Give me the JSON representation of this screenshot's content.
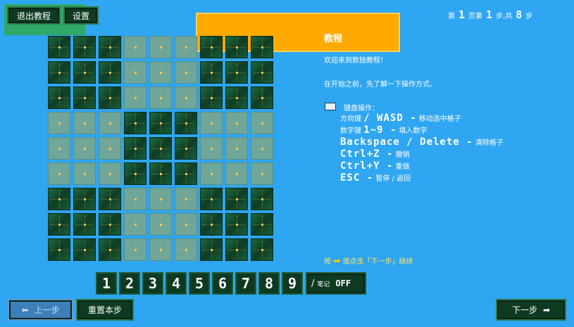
{
  "top_buttons": {
    "exit": "退出教程",
    "settings": "设置"
  },
  "step_counter": {
    "prefix": "第",
    "page": "1",
    "mid": "页第",
    "step": "1",
    "step_label": "步,共",
    "total": "8",
    "suffix": "步"
  },
  "title": "教程",
  "panel": {
    "welcome": "欢迎来到数独教程！",
    "intro": "在开始之前，先了解一下操作方式。",
    "keyboard_heading": "键盘操作：",
    "keyboard_icon": "keyboard-icon",
    "lines": [
      {
        "label": "方向键",
        "keys": "/ WASD -",
        "desc": "移动选中格子"
      },
      {
        "label": "数字键",
        "keys": "1~9 -",
        "desc": "填入数字"
      },
      {
        "label": "",
        "keys": "Backspace / Delete -",
        "desc": "清除格子"
      },
      {
        "label": "",
        "keys": "Ctrl+Z -",
        "desc": "撤销"
      },
      {
        "label": "",
        "keys": "Ctrl+Y -",
        "desc": "重做"
      },
      {
        "label": "",
        "keys": "ESC -",
        "desc": "暂停 / 返回"
      }
    ],
    "hint_prefix": "按",
    "hint_icon": "arrow-right-icon",
    "hint": "或点击「下一步」继续"
  },
  "grid": {
    "rows": [
      "dddlllddd",
      "dddlllddd",
      "dddlllddd",
      "llldddlll",
      "llldddlll",
      "llldddlll",
      "dddlllddd",
      "dddlllddd",
      "dddlllddd"
    ]
  },
  "number_buttons": [
    "1",
    "2",
    "3",
    "4",
    "5",
    "6",
    "7",
    "8",
    "9"
  ],
  "note_button": {
    "icon": "pencil-icon",
    "label": "笔记",
    "state": "OFF"
  },
  "bottom": {
    "prev": "上一步",
    "reset": "重置本步",
    "next": "下一步"
  },
  "colors": {
    "background": "#2fa6f2",
    "accent": "#ffaa00",
    "dark_cell": "#134d2e",
    "light_cell": "#6fa69a"
  }
}
